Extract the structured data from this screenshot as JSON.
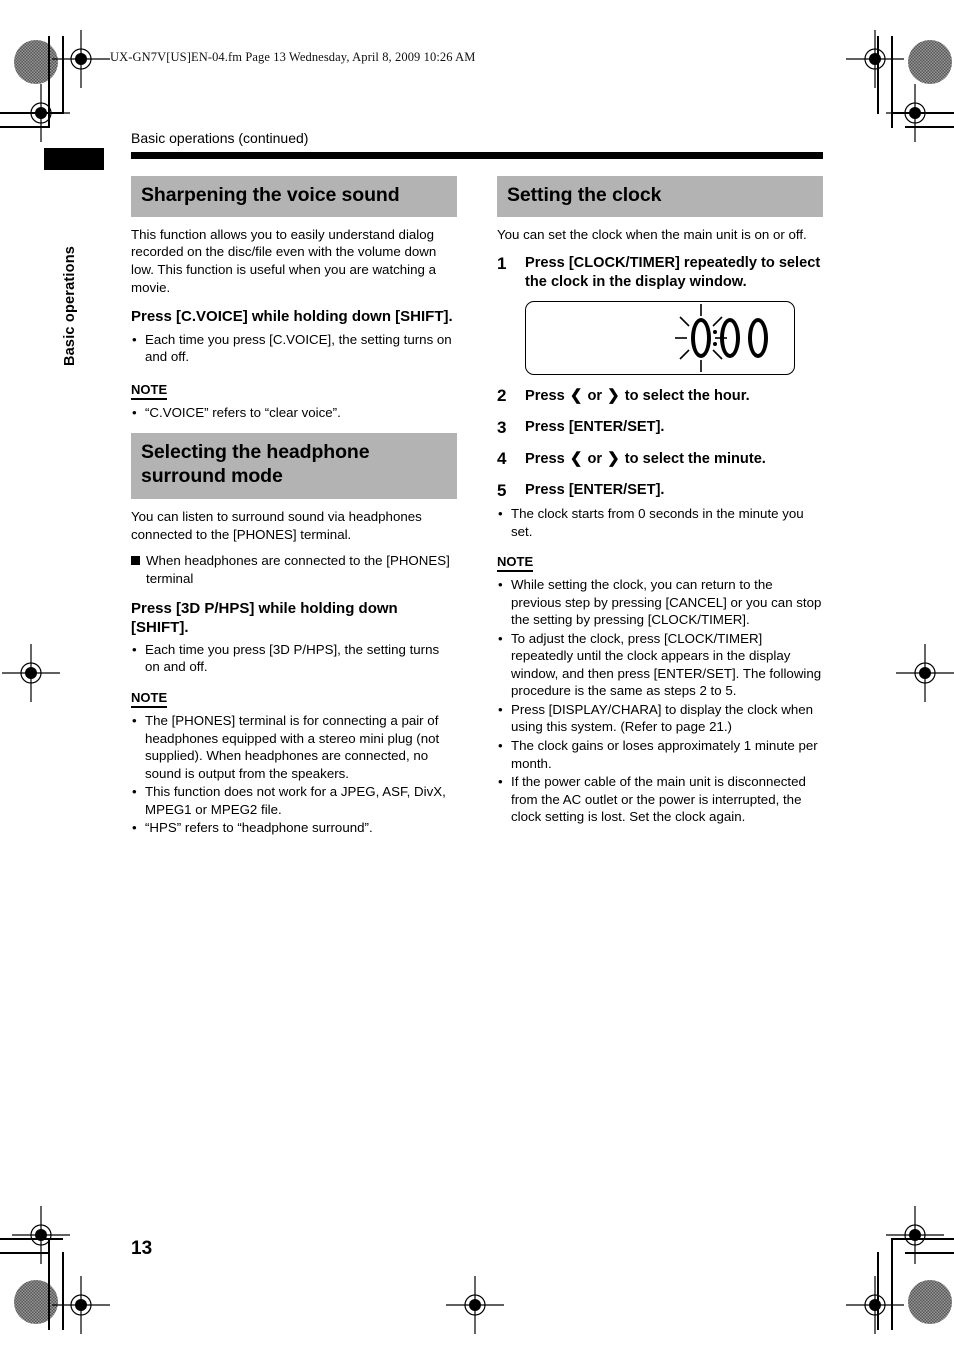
{
  "file_header": "UX-GN7V[US]EN-04.fm  Page 13  Wednesday, April 8, 2009  10:26 AM",
  "running_head": "Basic operations (continued)",
  "side_tab": "Basic operations",
  "page_number": "13",
  "colors": {
    "heading_bar": "#b3b3b3",
    "rule": "#000000"
  },
  "left_column": {
    "section1": {
      "heading": "Sharpening the voice sound",
      "intro": "This function allows you to easily understand dialog recorded on the disc/file even with the volume down low. This function is useful when you are watching a movie.",
      "instruction": "Press [C.VOICE] while holding down [SHIFT].",
      "bullets": [
        "Each time you press [C.VOICE], the setting turns on and off."
      ],
      "note_label": "NOTE",
      "notes": [
        "“C.VOICE” refers to “clear voice”."
      ]
    },
    "section2": {
      "heading": "Selecting the headphone surround mode",
      "intro": "You can listen to surround sound via headphones connected to the [PHONES] terminal.",
      "square_item": "When headphones are connected to the [PHONES] terminal",
      "instruction": "Press [3D P/HPS] while holding down [SHIFT].",
      "bullets": [
        "Each time you press [3D P/HPS], the setting turns on and off."
      ],
      "note_label": "NOTE",
      "notes": [
        "The [PHONES] terminal is for connecting a pair of headphones equipped with a stereo mini plug (not supplied). When headphones are connected, no sound is output from the speakers.",
        "This function does not work for a JPEG, ASF, DivX, MPEG1 or MPEG2 file.",
        "“HPS” refers to “headphone surround”."
      ]
    }
  },
  "right_column": {
    "heading": "Setting the clock",
    "intro": "You can set the clock when the main unit is on or off.",
    "steps": [
      {
        "num": "1",
        "text": "Press [CLOCK/TIMER] repeatedly to select the clock in the display window."
      },
      {
        "num": "2",
        "text_before": "Press",
        "chev_left": "❮",
        "or": "or",
        "chev_right": "❯",
        "text_after": "to select the hour."
      },
      {
        "num": "3",
        "text": "Press [ENTER/SET]."
      },
      {
        "num": "4",
        "text_before": "Press",
        "chev_left": "❮",
        "or": "or",
        "chev_right": "❯",
        "text_after": "to select the minute."
      },
      {
        "num": "5",
        "text": "Press [ENTER/SET]."
      }
    ],
    "step5_bullets": [
      "The clock starts from 0 seconds in the minute you set."
    ],
    "clock_display": {
      "value": "0:00",
      "blinking_digit": "0",
      "description": "display window showing 0:00 with blinking hour digit"
    },
    "note_label": "NOTE",
    "notes": [
      "While setting the clock, you can return to the previous step by pressing [CANCEL] or you can stop the setting by pressing [CLOCK/TIMER].",
      "To adjust the clock, press [CLOCK/TIMER] repeatedly until the clock appears in the display window, and then press [ENTER/SET]. The following procedure is the same as steps 2 to 5.",
      "Press [DISPLAY/CHARA] to display the clock when using this system. (Refer to page 21.)",
      "The clock gains or loses approximately 1 minute per month.",
      "If the power cable of the main unit is disconnected from the AC outlet or the power is interrupted, the clock setting is lost. Set the clock again."
    ]
  }
}
